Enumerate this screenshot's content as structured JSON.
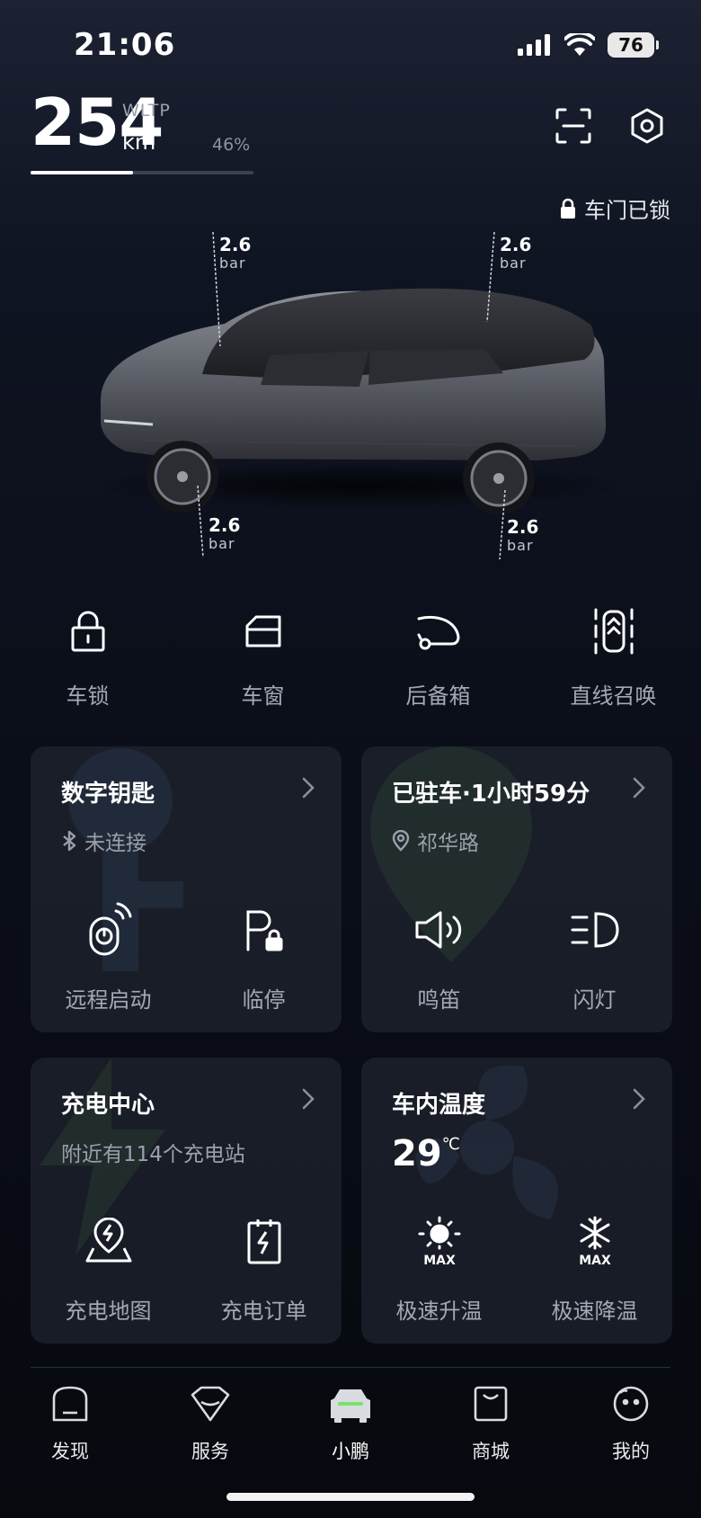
{
  "status_bar": {
    "time": "21:06",
    "battery": "76"
  },
  "range": {
    "value": "254",
    "unit": "km",
    "standard": "WLTP",
    "percent": "46%",
    "fill_fraction": 0.46
  },
  "door_status": "车门已锁",
  "tires": {
    "front_left": {
      "value": "2.6",
      "unit": "bar"
    },
    "rear_left": {
      "value": "2.6",
      "unit": "bar"
    },
    "front_right": {
      "value": "2.6",
      "unit": "bar"
    },
    "rear_right": {
      "value": "2.6",
      "unit": "bar"
    }
  },
  "quick_actions": [
    {
      "label": "车锁",
      "icon": "lock-icon"
    },
    {
      "label": "车窗",
      "icon": "window-icon"
    },
    {
      "label": "后备箱",
      "icon": "trunk-icon"
    },
    {
      "label": "直线召唤",
      "icon": "summon-icon"
    }
  ],
  "cards": {
    "digital_key": {
      "title": "数字钥匙",
      "subtitle": "未连接",
      "actions": [
        "远程启动",
        "临停"
      ]
    },
    "parking": {
      "title": "已驻车·1小时59分",
      "subtitle": "祁华路",
      "actions": [
        "鸣笛",
        "闪灯"
      ]
    },
    "charging": {
      "title": "充电中心",
      "subtitle": "附近有114个充电站",
      "actions": [
        "充电地图",
        "充电订单"
      ]
    },
    "climate": {
      "title": "车内温度",
      "temp": "29",
      "temp_unit": "℃",
      "actions": [
        "极速升温",
        "极速降温"
      ],
      "max_label": "MAX"
    }
  },
  "tabs": [
    {
      "label": "发现"
    },
    {
      "label": "服务"
    },
    {
      "label": "小鹏",
      "active": true
    },
    {
      "label": "商城"
    },
    {
      "label": "我的"
    }
  ],
  "colors": {
    "accent": "#7fe06a",
    "bg": "#0b0f1a"
  }
}
